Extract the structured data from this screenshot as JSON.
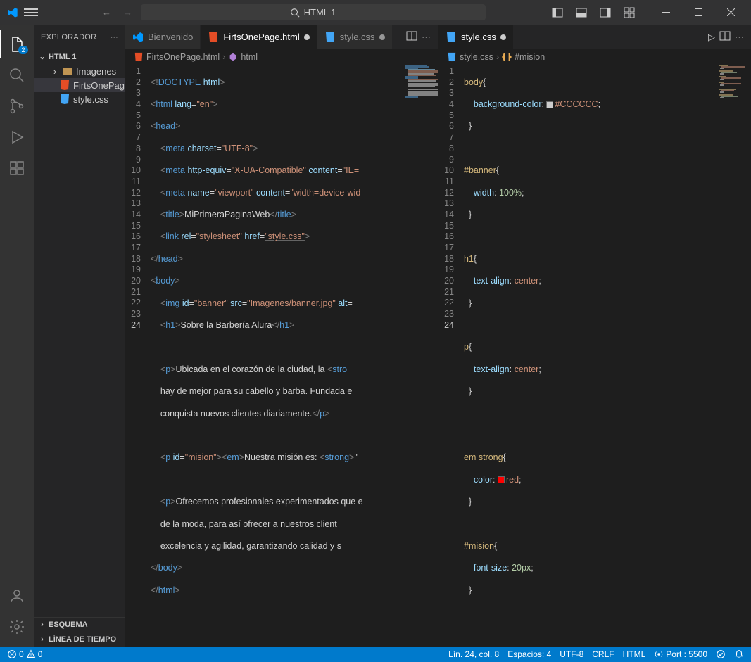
{
  "titlebar": {
    "search_text": "HTML 1"
  },
  "activity": {
    "explorer_badge": "2"
  },
  "sidebar": {
    "title": "EXPLORADOR",
    "root": "HTML 1",
    "folder_imagenes": "Imagenes",
    "file_firts": "FirtsOnePage.html",
    "file_style": "style.css",
    "esquema": "ESQUEMA",
    "linea": "LÍNEA DE TIEMPO"
  },
  "tabsLeft": {
    "bienvenido": "Bienvenido",
    "firts": "FirtsOnePage.html",
    "style": "style.css"
  },
  "tabsRight": {
    "style": "style.css"
  },
  "breadcrumbLeft": {
    "file": "FirtsOnePage.html",
    "el": "html"
  },
  "breadcrumbRight": {
    "file": "style.css",
    "el": "#mision"
  },
  "statusbar": {
    "errors": "0",
    "warnings": "0",
    "lncol": "Lín. 24, col. 8",
    "spaces": "Espacios: 4",
    "encoding": "UTF-8",
    "eol": "CRLF",
    "lang": "HTML",
    "port": "Port : 5500"
  },
  "codeLeft": {
    "l1": {
      "a": "<!",
      "b": "DOCTYPE ",
      "c": "html",
      "d": ">"
    },
    "l2": {
      "a": "<",
      "b": "html ",
      "c": "lang",
      "d": "=",
      "e": "\"en\"",
      "f": ">"
    },
    "l3": {
      "a": "<",
      "b": "head",
      "c": ">"
    },
    "l4": {
      "a": "<",
      "b": "meta ",
      "c": "charset",
      "d": "=",
      "e": "\"UTF-8\"",
      "f": ">"
    },
    "l5": {
      "a": "<",
      "b": "meta ",
      "c": "http-equiv",
      "d": "=",
      "e": "\"X-UA-Compatible\"",
      "f": " ",
      "g": "content",
      "h": "=",
      "i": "\"IE="
    },
    "l6": {
      "a": "<",
      "b": "meta ",
      "c": "name",
      "d": "=",
      "e": "\"viewport\"",
      "f": " ",
      "g": "content",
      "h": "=",
      "i": "\"width=device-wid"
    },
    "l7": {
      "a": "<",
      "b": "title",
      "c": ">",
      "d": "MiPrimeraPaginaWeb",
      "e": "</",
      "f": "title",
      "g": ">"
    },
    "l8": {
      "a": "<",
      "b": "link ",
      "c": "rel",
      "d": "=",
      "e": "\"stylesheet\"",
      "f": " ",
      "g": "href",
      "h": "=",
      "i": "\"style.css\"",
      "j": ">"
    },
    "l9": {
      "a": "</",
      "b": "head",
      "c": ">"
    },
    "l10": {
      "a": "<",
      "b": "body",
      "c": ">"
    },
    "l11": {
      "a": "<",
      "b": "img ",
      "c": "id",
      "d": "=",
      "e": "\"banner\"",
      "f": " ",
      "g": "src",
      "h": "=",
      "i": "\"Imagenes/banner.jpg\"",
      "j": " ",
      "k": "alt",
      "l": "="
    },
    "l12": {
      "a": "<",
      "b": "h1",
      "c": ">",
      "d": "Sobre la Barbería Alura",
      "e": "</",
      "f": "h1",
      "g": ">"
    },
    "l14": {
      "a": "<",
      "b": "p",
      "c": ">",
      "d": "Ubicada en el corazón de la ciudad, la ",
      "e": "<",
      "f": "stro"
    },
    "l15": {
      "a": "hay de mejor para su cabello y barba. Fundada e"
    },
    "l16": {
      "a": "conquista nuevos clientes diariamente.",
      "b": "</",
      "c": "p",
      "d": ">"
    },
    "l18": {
      "a": "<",
      "b": "p ",
      "c": "id",
      "d": "=",
      "e": "\"mision\"",
      "f": "><",
      "g": "em",
      "h": ">",
      "i": "Nuestra misión es: ",
      "j": "<",
      "k": "strong",
      "l": ">",
      "m": "\""
    },
    "l20": {
      "a": "<",
      "b": "p",
      "c": ">",
      "d": "Ofrecemos profesionales experimentados que e"
    },
    "l21": {
      "a": "de la moda, para así ofrecer a nuestros client"
    },
    "l22": {
      "a": "excelencia y agilidad, garantizando calidad y s"
    },
    "l23": {
      "a": "</",
      "b": "body",
      "c": ">"
    },
    "l24": {
      "a": "</",
      "b": "html",
      "c": ">"
    }
  },
  "codeRight": {
    "l1": {
      "a": "body",
      "b": "{"
    },
    "l2": {
      "a": "background-color",
      "b": ": ",
      "c": "#CCCCCC",
      "d": ";"
    },
    "l3": {
      "a": "}"
    },
    "l5": {
      "a": "#banner",
      "b": "{"
    },
    "l6": {
      "a": "width",
      "b": ": ",
      "c": "100%",
      "d": ";"
    },
    "l7": {
      "a": "}"
    },
    "l9": {
      "a": "h1",
      "b": "{"
    },
    "l10": {
      "a": "text-align",
      "b": ": ",
      "c": "center",
      "d": ";"
    },
    "l11": {
      "a": "}"
    },
    "l13": {
      "a": "p",
      "b": "{"
    },
    "l14": {
      "a": "text-align",
      "b": ": ",
      "c": "center",
      "d": ";"
    },
    "l15": {
      "a": "}"
    },
    "l18": {
      "a": "em strong",
      "b": "{"
    },
    "l19": {
      "a": "color",
      "b": ": ",
      "c": "red",
      "d": ";"
    },
    "l20": {
      "a": "}"
    },
    "l22": {
      "a": "#mision",
      "b": "{"
    },
    "l23": {
      "a": "font-size",
      "b": ": ",
      "c": "20px",
      "d": ";"
    },
    "l24": {
      "a": "}"
    }
  }
}
